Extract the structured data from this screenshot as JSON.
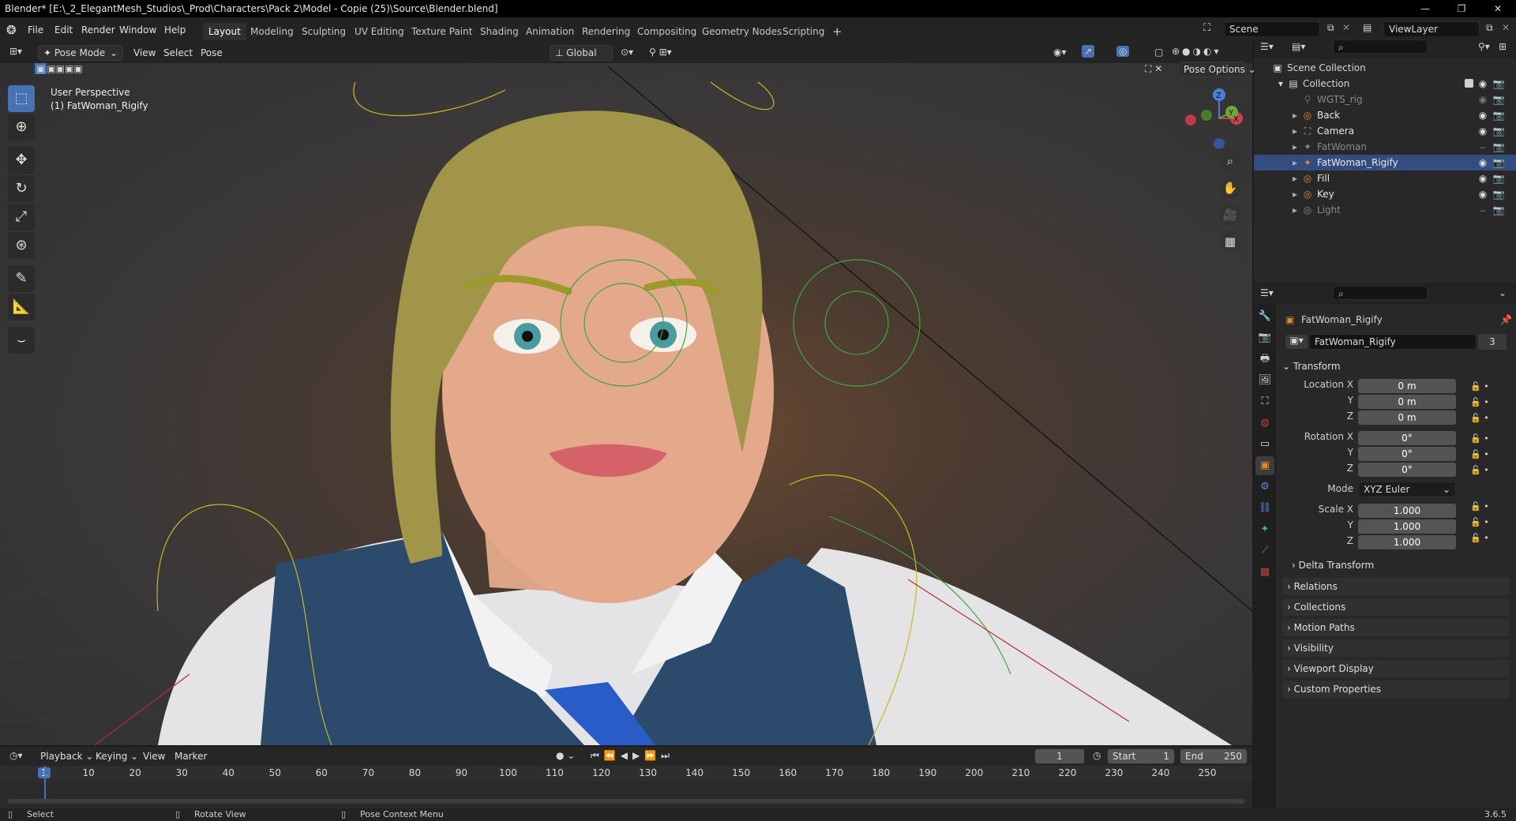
{
  "window": {
    "title": "Blender* [E:\\_2_ElegantMesh_Studios\\_Prod\\Characters\\Pack 2\\Model - Copie (25)\\Source\\Blender.blend]",
    "minimize": "—",
    "maximize": "❐",
    "close": "✕"
  },
  "menus": [
    "File",
    "Edit",
    "Render",
    "Window",
    "Help"
  ],
  "workspaces": [
    {
      "label": "Layout",
      "active": true
    },
    {
      "label": "Modeling",
      "active": false
    },
    {
      "label": "Sculpting",
      "active": false
    },
    {
      "label": "UV Editing",
      "active": false
    },
    {
      "label": "Texture Paint",
      "active": false
    },
    {
      "label": "Shading",
      "active": false
    },
    {
      "label": "Animation",
      "active": false
    },
    {
      "label": "Rendering",
      "active": false
    },
    {
      "label": "Compositing",
      "active": false
    },
    {
      "label": "Geometry Nodes",
      "active": false
    },
    {
      "label": "Scripting",
      "active": false
    }
  ],
  "add_workspace": "+",
  "scene": {
    "label": "Scene",
    "view_layer": "ViewLayer"
  },
  "viewport": {
    "mode": "Pose Mode",
    "menus": [
      "View",
      "Select",
      "Pose"
    ],
    "orientation": "Global",
    "pose_options": "Pose Options",
    "overlay_text_1": "User Perspective",
    "overlay_text_2": "(1) FatWoman_Rigify",
    "gizmo": {
      "z": "Z",
      "y": "Y",
      "x": "X"
    }
  },
  "outliner": {
    "root": "Scene Collection",
    "collection": "Collection",
    "items": [
      {
        "label": "WGTS_rig",
        "dim": true,
        "selected": false
      },
      {
        "label": "Back",
        "dim": false,
        "selected": false
      },
      {
        "label": "Camera",
        "dim": false,
        "selected": false
      },
      {
        "label": "FatWoman",
        "dim": true,
        "selected": false
      },
      {
        "label": "FatWoman_Rigify",
        "dim": false,
        "selected": true
      },
      {
        "label": "Fill",
        "dim": false,
        "selected": false
      },
      {
        "label": "Key",
        "dim": false,
        "selected": false
      },
      {
        "label": "Light",
        "dim": true,
        "selected": false
      }
    ]
  },
  "properties": {
    "object_name": "FatWoman_Rigify",
    "datablock_name": "FatWoman_Rigify",
    "datablock_users": "3",
    "transform": {
      "header": "Transform",
      "location_label": "Location X",
      "location": [
        "0 m",
        "0 m",
        "0 m"
      ],
      "rotation_label": "Rotation X",
      "rotation": [
        "0°",
        "0°",
        "0°"
      ],
      "mode_label": "Mode",
      "mode": "XYZ Euler",
      "scale_label": "Scale X",
      "scale": [
        "1.000",
        "1.000",
        "1.000"
      ],
      "y": "Y",
      "z": "Z"
    },
    "delta": "Delta Transform",
    "panels": [
      "Relations",
      "Collections",
      "Motion Paths",
      "Visibility",
      "Viewport Display",
      "Custom Properties"
    ]
  },
  "timeline": {
    "menus": [
      "Playback",
      "Keying",
      "View",
      "Marker"
    ],
    "current_frame": "1",
    "start_label": "Start",
    "start": "1",
    "end_label": "End",
    "end": "250",
    "ticks": [
      "1",
      "10",
      "20",
      "30",
      "40",
      "50",
      "60",
      "70",
      "80",
      "90",
      "100",
      "110",
      "120",
      "130",
      "140",
      "150",
      "160",
      "170",
      "180",
      "190",
      "200",
      "210",
      "220",
      "230",
      "240",
      "250"
    ]
  },
  "status": {
    "select": "Select",
    "rotate": "Rotate View",
    "context": "Pose Context Menu",
    "version": "3.6.5"
  },
  "colors": {
    "accent": "#4772b3",
    "selected_row": "#334d80",
    "hair": "#a89a4a",
    "skin": "#e0a888",
    "vest": "#2a4a6a"
  }
}
